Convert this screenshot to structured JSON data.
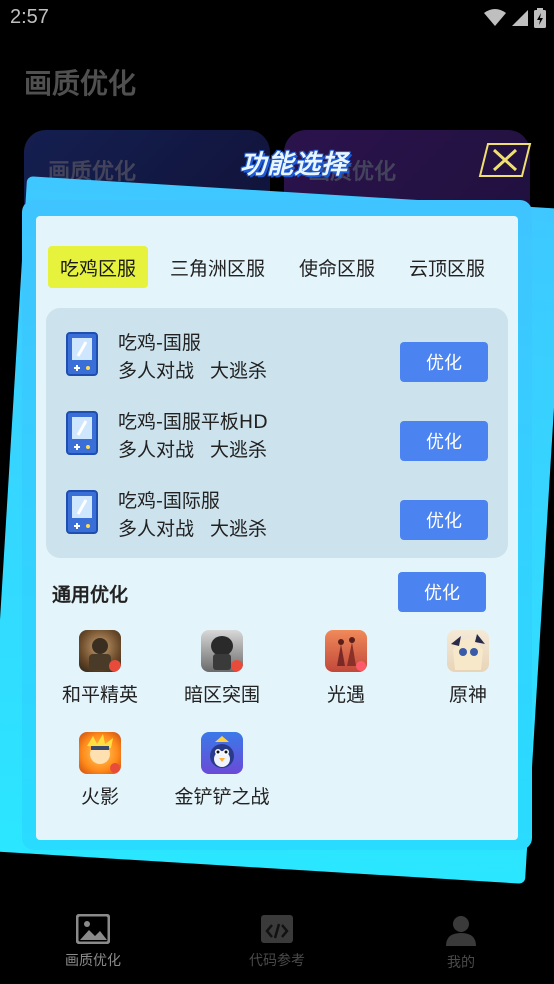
{
  "status_bar": {
    "time": "2:57"
  },
  "page": {
    "title": "画质优化",
    "card_left_label": "画质优化",
    "card_right_label": "画质优化"
  },
  "modal": {
    "title": "功能选择",
    "tabs": [
      "吃鸡区服",
      "三角洲区服",
      "使命区服",
      "云顶区服"
    ],
    "active_tab": 0,
    "games": [
      {
        "name": "吃鸡-国服",
        "tags": [
          "多人对战",
          "大逃杀"
        ],
        "button": "优化"
      },
      {
        "name": "吃鸡-国服平板HD",
        "tags": [
          "多人对战",
          "大逃杀"
        ],
        "button": "优化"
      },
      {
        "name": "吃鸡-国际服",
        "tags": [
          "多人对战",
          "大逃杀"
        ],
        "button": "优化"
      }
    ],
    "general": {
      "title": "通用优化",
      "button": "优化"
    },
    "apps": [
      {
        "label": "和平精英",
        "icon": "peace-elite-icon"
      },
      {
        "label": "暗区突围",
        "icon": "arena-breakout-icon"
      },
      {
        "label": "光遇",
        "icon": "sky-icon"
      },
      {
        "label": "原神",
        "icon": "genshin-icon"
      },
      {
        "label": "火影",
        "icon": "naruto-icon"
      },
      {
        "label": "金铲铲之战",
        "icon": "golden-spatula-icon"
      }
    ]
  },
  "bottom_nav": [
    {
      "label": "画质优化",
      "icon": "image-icon",
      "active": true
    },
    {
      "label": "代码参考",
      "icon": "code-icon",
      "active": false
    },
    {
      "label": "我的",
      "icon": "person-icon",
      "active": false
    }
  ],
  "colors": {
    "accent": "#4b84f0",
    "active_tab": "#e6f23c",
    "frame": "#3fc4ff",
    "panel": "#e4f4fb"
  }
}
